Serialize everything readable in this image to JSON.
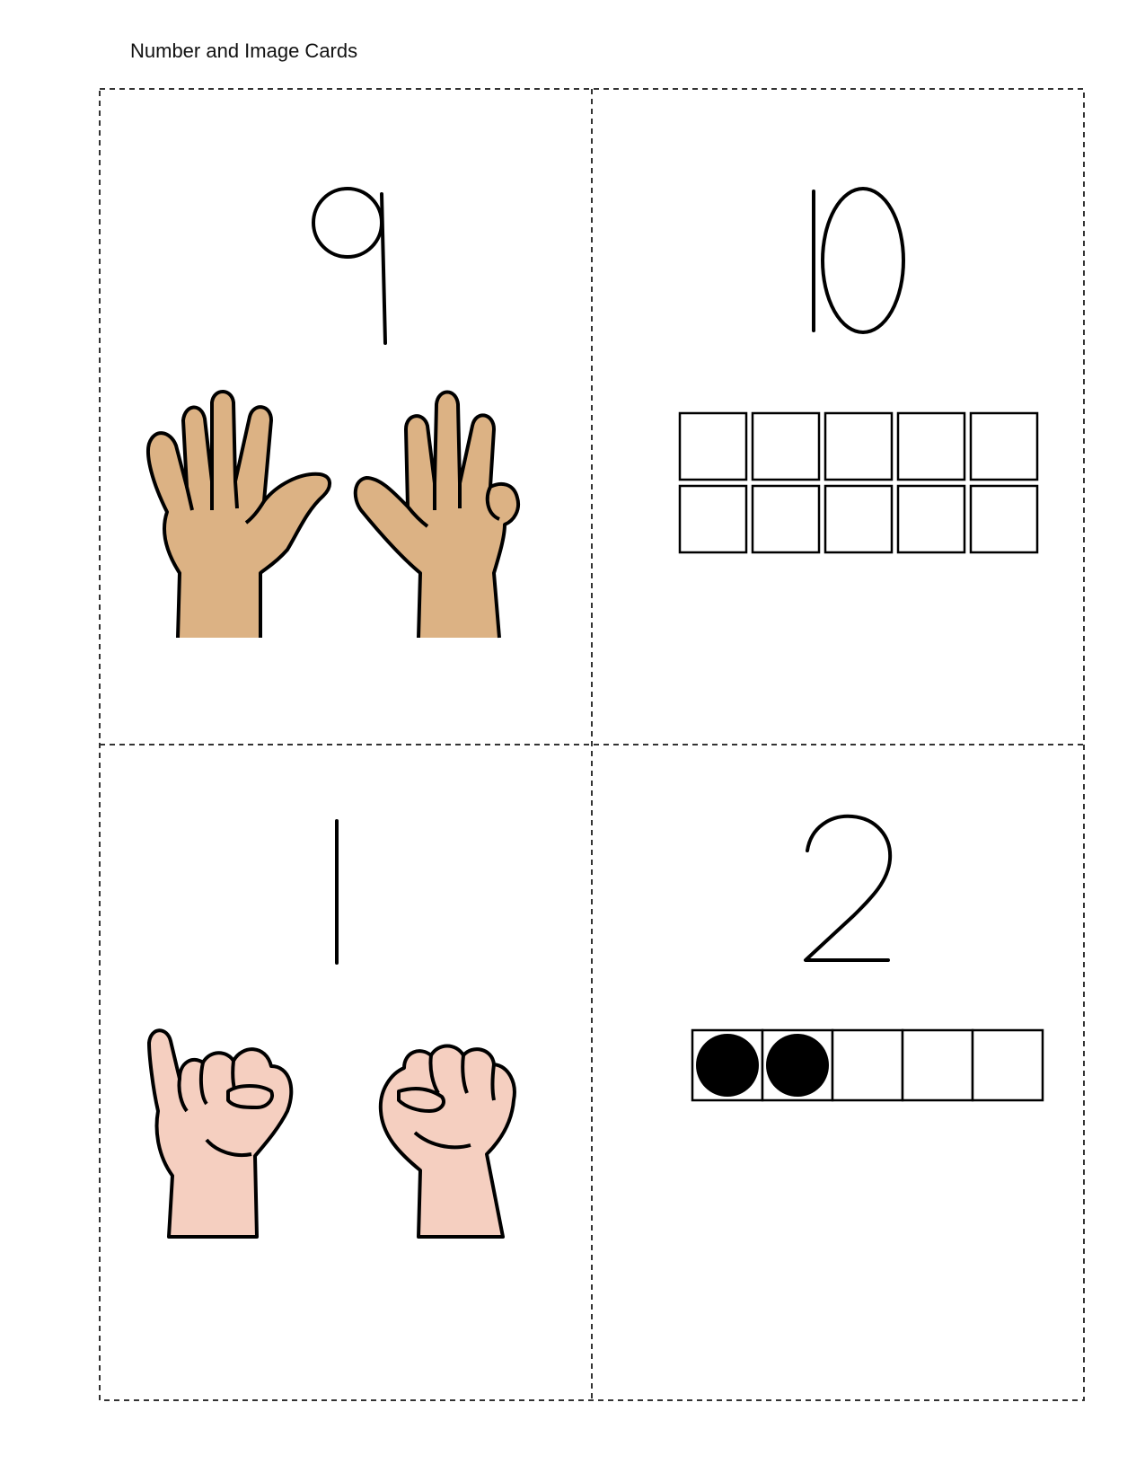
{
  "header": {
    "title": "Number and Image Cards"
  },
  "cards": [
    {
      "number": 9,
      "image": "hands-five-and-four-fingers",
      "skin_color": "#dcb284"
    },
    {
      "number": 10,
      "image": "ten-frame-empty",
      "frame_filled": 0,
      "frame_cells": 10
    },
    {
      "number": 1,
      "image": "hands-one-finger-and-fist",
      "skin_color": "#f5cfc0"
    },
    {
      "number": 2,
      "image": "five-frame-with-dots",
      "frame_filled": 2,
      "frame_cells": 5
    }
  ],
  "colors": {
    "outline": "#000000",
    "dashed_border": "#333333"
  }
}
